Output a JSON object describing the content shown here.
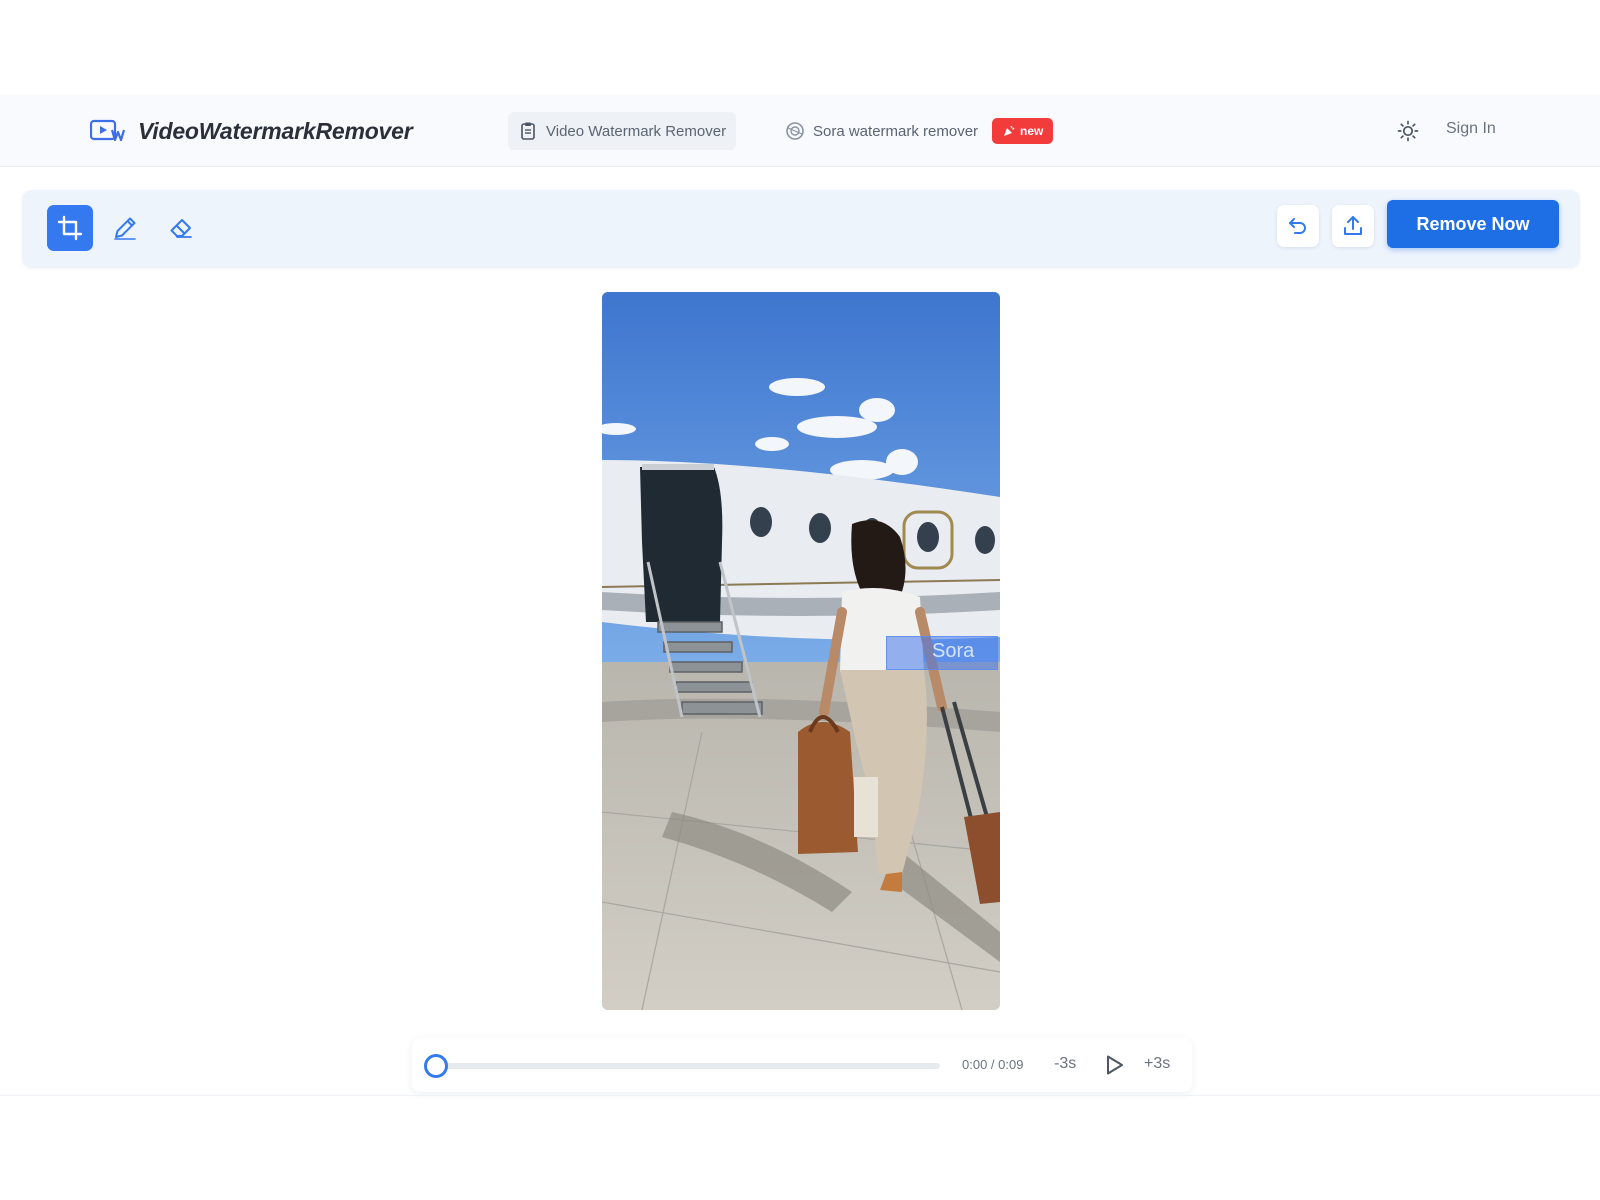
{
  "brand": {
    "name": "VideoWatermarkRemover",
    "icon": "video-logo-icon"
  },
  "nav": {
    "tabs": [
      {
        "label": "Video Watermark Remover",
        "icon": "clipboard-icon",
        "active": true
      },
      {
        "label": "Sora watermark remover",
        "icon": "sora-logo-icon",
        "active": false
      }
    ],
    "badge": {
      "label": "new",
      "icon": "party-icon"
    }
  },
  "header_actions": {
    "theme_icon": "sun-icon",
    "signin_label": "Sign In"
  },
  "toolbar": {
    "tools": [
      {
        "name": "crop",
        "icon": "crop-icon",
        "selected": true
      },
      {
        "name": "pencil",
        "icon": "pencil-icon",
        "selected": false
      },
      {
        "name": "eraser",
        "icon": "eraser-icon",
        "selected": false
      }
    ],
    "undo_icon": "undo-icon",
    "upload_icon": "upload-icon",
    "remove_label": "Remove Now"
  },
  "video": {
    "watermark_text": "Sora"
  },
  "player": {
    "progress": 0,
    "time": "0:00 / 0:09",
    "back_label": "-3s",
    "forward_label": "+3s",
    "play_icon": "play-icon"
  },
  "colors": {
    "accent": "#3479f0",
    "primary_button": "#1e6fe6",
    "badge": "#f23b3b",
    "toolbar_bg": "#eef4fc"
  }
}
